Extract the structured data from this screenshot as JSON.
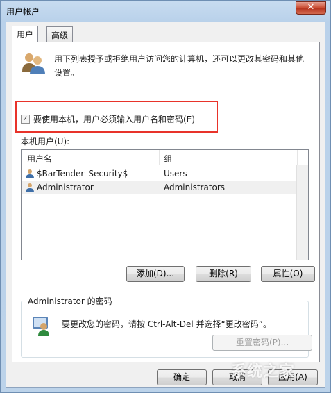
{
  "window": {
    "title": "用户帐户",
    "close_glyph": "✕"
  },
  "tabs": [
    {
      "label": "用户"
    },
    {
      "label": "高级"
    }
  ],
  "intro_text": "用下列表授予或拒绝用户访问您的计算机，还可以更改其密码和其他设置。",
  "require_login": {
    "label": "要使用本机，用户必须输入用户名和密码(E)",
    "checked": true,
    "check_glyph": "✓"
  },
  "local_users": {
    "label": "本机用户(U):",
    "columns": [
      "用户名",
      "组"
    ],
    "rows": [
      {
        "name": "$BarTender_Security$",
        "group": "Users",
        "selected": false
      },
      {
        "name": "Administrator",
        "group": "Administrators",
        "selected": true
      }
    ]
  },
  "buttons": {
    "add": "添加(D)...",
    "remove": "删除(R)",
    "properties": "属性(O)",
    "reset_password": "重置密码(P)...",
    "ok": "确定",
    "cancel": "取消",
    "apply": "应用(A)"
  },
  "password_group": {
    "legend": "Administrator 的密码",
    "text": "要更改您的密码，请按 Ctrl-Alt-Del 并选择“更改密码”。"
  },
  "watermark": "系统之家",
  "icons": {
    "users": "users-icon",
    "user": "user-icon",
    "password": "password-user-icon"
  }
}
